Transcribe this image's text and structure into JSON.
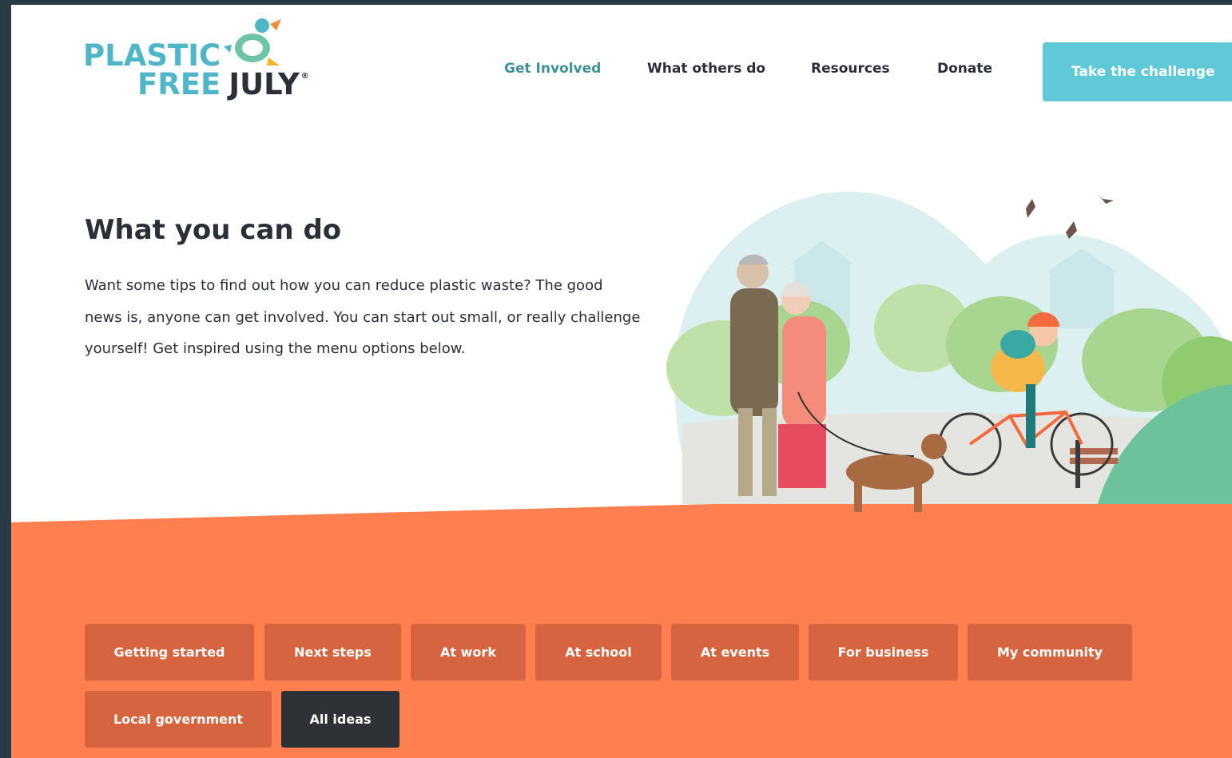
{
  "header": {
    "logo": {
      "line1": "PLASTIC",
      "free": "FREE",
      "july": "JULY",
      "reg": "®"
    },
    "nav": [
      {
        "label": "Get Involved",
        "active": true
      },
      {
        "label": "What others do",
        "active": false
      },
      {
        "label": "Resources",
        "active": false
      },
      {
        "label": "Donate",
        "active": false
      }
    ],
    "cta_label": "Take the challenge"
  },
  "hero": {
    "title": "What you can do",
    "text": "Want some tips to find out how you can reduce plastic waste? The good news is, anyone can get involved. You can start out small, or really challenge yourself! Get inspired using the menu options below."
  },
  "filters": [
    {
      "label": "Getting started",
      "selected": false
    },
    {
      "label": "Next steps",
      "selected": false
    },
    {
      "label": "At work",
      "selected": false
    },
    {
      "label": "At school",
      "selected": false
    },
    {
      "label": "At events",
      "selected": false
    },
    {
      "label": "For business",
      "selected": false
    },
    {
      "label": "My community",
      "selected": false
    },
    {
      "label": "Local government",
      "selected": false
    },
    {
      "label": "All ideas",
      "selected": true
    }
  ],
  "colors": {
    "brand_teal": "#4fb6c7",
    "cta": "#60c9d8",
    "band_orange": "#ff7f50",
    "filter_button": "#d6653f",
    "filter_selected": "#2e3136",
    "frame": "#283a44"
  }
}
